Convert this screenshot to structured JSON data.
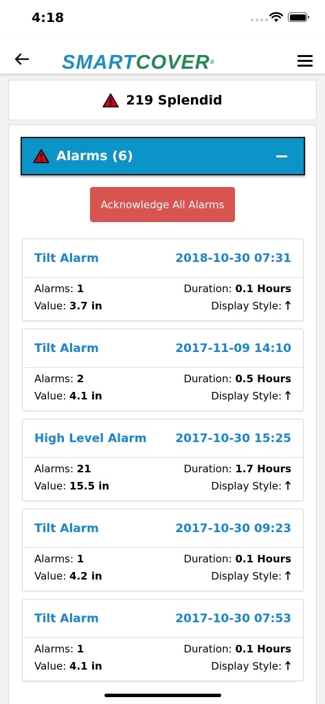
{
  "status_bar": {
    "time": "4:18"
  },
  "nav": {
    "logo_smart": "SMART",
    "logo_cover": "COVER",
    "logo_reg": "®"
  },
  "site": {
    "name": "219 Splendid"
  },
  "alarms_panel": {
    "title": "Alarms (6)",
    "ack_button_label": "Acknowledge All Alarms"
  },
  "labels": {
    "alarms": "Alarms:",
    "value": "Value:",
    "duration": "Duration:",
    "display_style": "Display Style:"
  },
  "alarms": [
    {
      "type": "Tilt Alarm",
      "date": "2018-10-30 07:31",
      "count": "1",
      "value": "3.7 in",
      "duration": "0.1 Hours"
    },
    {
      "type": "Tilt Alarm",
      "date": "2017-11-09 14:10",
      "count": "2",
      "value": "4.1 in",
      "duration": "0.5 Hours"
    },
    {
      "type": "High Level Alarm",
      "date": "2017-10-30 15:25",
      "count": "21",
      "value": "15.5 in",
      "duration": "1.7 Hours"
    },
    {
      "type": "Tilt Alarm",
      "date": "2017-10-30 09:23",
      "count": "1",
      "value": "4.2 in",
      "duration": "0.1 Hours"
    },
    {
      "type": "Tilt Alarm",
      "date": "2017-10-30 07:53",
      "count": "1",
      "value": "4.1 in",
      "duration": "0.1 Hours"
    }
  ],
  "colors": {
    "header_blue": "#0b94c8",
    "link_blue": "#1686d8",
    "ack_red": "#d9534f",
    "warning_red": "#d0021b",
    "logo_blue": "#1a8fc6",
    "logo_green": "#1f8a52"
  },
  "icons": {
    "back": "arrow-left-icon",
    "menu": "hamburger-menu-icon",
    "warning": "warning-triangle-icon",
    "collapse": "minus-icon",
    "display_style": "arrow-up-icon"
  }
}
